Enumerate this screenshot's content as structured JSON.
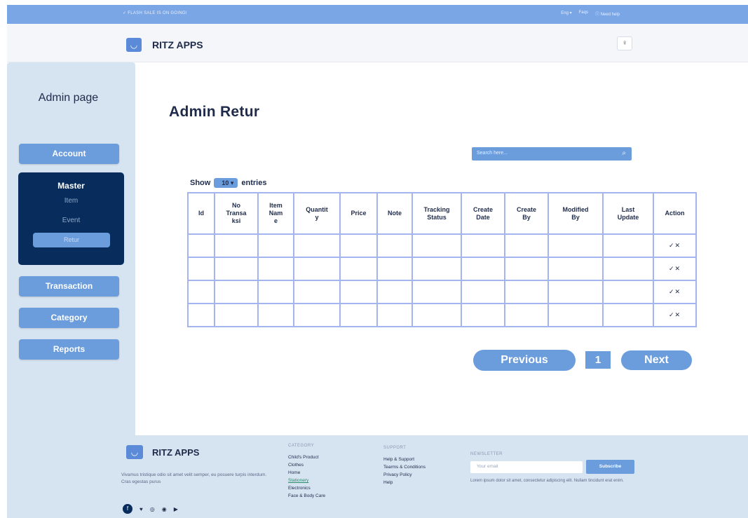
{
  "topbar": {
    "flash_text": "✓ FLASH SALE IS ON GOING!",
    "lang": "Eng ▾",
    "faqs": "Faqs",
    "help": "ⓘ Need help"
  },
  "header": {
    "brand": "RITZ APPS",
    "logo_glyph": "◡",
    "user_glyph": "♀"
  },
  "sidebar": {
    "title": "Admin page",
    "account": "Account",
    "master": {
      "title": "Master",
      "items": [
        "Item",
        "Event",
        "Retur"
      ]
    },
    "transaction": "Transaction",
    "category": "Category",
    "reports": "Reports"
  },
  "main": {
    "title": "Admin Retur",
    "search_placeholder": "Search here...",
    "search_icon": "⌕",
    "show_label": "Show",
    "entries_value": "10",
    "entries_label": "entries"
  },
  "table": {
    "headers": [
      "Id",
      "No\nTransa\nksi",
      "Item\nNam\ne",
      "Quantit\ny",
      "Price",
      "Note",
      "Tracking\nStatus",
      "Create\nDate",
      "Create\nBy",
      "Modified\nBy",
      "Last\nUpdate",
      "Action"
    ],
    "action_glyph": "✓✕"
  },
  "pagination": {
    "previous": "Previous",
    "page": "1",
    "next": "Next"
  },
  "footer": {
    "brand": "RITZ APPS",
    "logo_glyph": "◡",
    "description": "Vivamus tristique odio sit amet velit semper, eu posuere turpis interdum. Cras egestas purus",
    "category_heading": "CATEGORY",
    "categories": [
      "Child's Product",
      "Clothes",
      "Home",
      "Stationery",
      "Electronics",
      "Face & Body Care"
    ],
    "support_heading": "SUPPORT",
    "support": [
      "Help & Support",
      "Tearms & Conditions",
      "Privacy Policy",
      "Help"
    ],
    "newsletter_heading": "NEWSLETTER",
    "email_placeholder": "Your email",
    "subscribe": "Subscribe",
    "newsletter_note": "Lorem ipsum dolor sit amet, consectetur adipiscing elit. Nullam tincidunt erat enim.",
    "social": [
      "f",
      "♥",
      "◎",
      "◉",
      "▶"
    ]
  }
}
